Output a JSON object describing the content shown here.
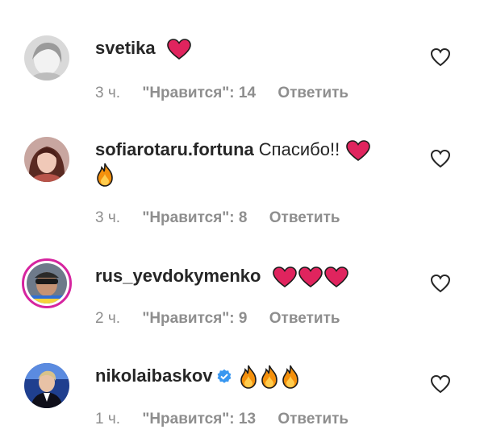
{
  "comments": [
    {
      "username": "svetika",
      "text": "",
      "emojis": "❤️",
      "time": "3 ч.",
      "likes": "\"Нравится\": 14",
      "reply": "Ответить",
      "verified": false
    },
    {
      "username": "sofiarotaru.fortuna",
      "text": "Спасибо!!",
      "emojis": "❤️🔥",
      "time": "3 ч.",
      "likes": "\"Нравится\": 8",
      "reply": "Ответить",
      "verified": false
    },
    {
      "username": "rus_yevdokymenko",
      "text": "",
      "emojis": "❤️❤️❤️",
      "time": "2 ч.",
      "likes": "\"Нравится\": 9",
      "reply": "Ответить",
      "verified": false
    },
    {
      "username": "nikolaibaskov",
      "text": "",
      "emojis": "🔥🔥🔥",
      "time": "1 ч.",
      "likes": "\"Нравится\": 13",
      "reply": "Ответить",
      "verified": true
    }
  ],
  "colors": {
    "heart": "#e0245e",
    "fire": "#f4900c",
    "verified": "#3897f0",
    "meta": "#8e8e8e",
    "text": "#262626"
  },
  "icons": {
    "like": "heart-outline-icon",
    "verified": "verified-badge-icon"
  }
}
